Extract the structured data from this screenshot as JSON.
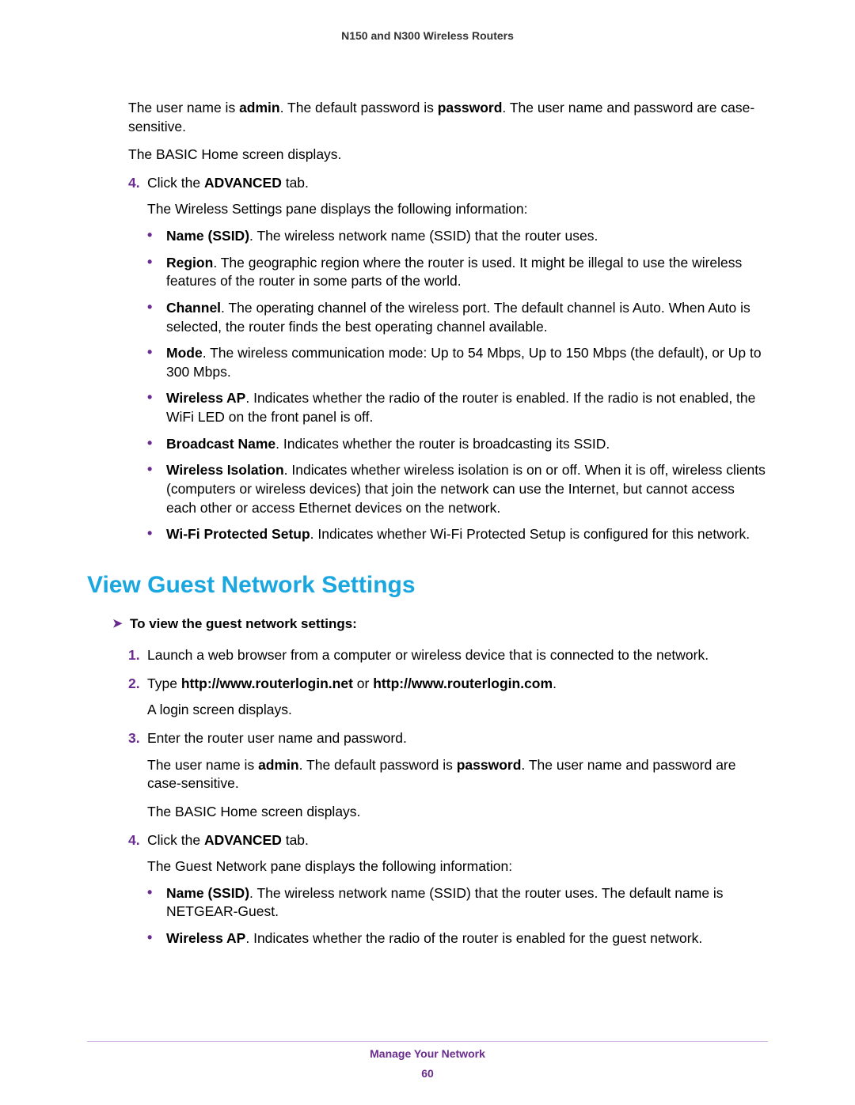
{
  "header": {
    "doc_title": "N150 and N300 Wireless Routers"
  },
  "intro": {
    "p1_a": "The user name is ",
    "p1_b_admin": "admin",
    "p1_c": ". The default password is ",
    "p1_d_password": "password",
    "p1_e": ". The user name and password are case-sensitive.",
    "p2": "The BASIC Home screen displays."
  },
  "step4a": {
    "num": "4.",
    "a": "Click the ",
    "b_adv": "ADVANCED",
    "c": " tab.",
    "follow": "The Wireless Settings pane displays the following information:"
  },
  "bulletsA": [
    {
      "term": "Name (SSID)",
      "text": ". The wireless network name (SSID) that the router uses."
    },
    {
      "term": "Region",
      "text": ". The geographic region where the router is used. It might be illegal to use the wireless features of the router in some parts of the world."
    },
    {
      "term": "Channel",
      "text": ". The operating channel of the wireless port. The default channel is Auto. When Auto is selected, the router finds the best operating channel available."
    },
    {
      "term": "Mode",
      "text": ". The wireless communication mode: Up to 54 Mbps, Up to 150 Mbps (the default), or Up to 300 Mbps."
    },
    {
      "term": "Wireless AP",
      "text": ". Indicates whether the radio of the router is enabled. If the radio is not enabled, the WiFi LED on the front panel is off."
    },
    {
      "term": "Broadcast Name",
      "text": ". Indicates whether the router is broadcasting its SSID."
    },
    {
      "term": "Wireless Isolation",
      "text": ". Indicates whether wireless isolation is on or off. When it is off, wireless clients (computers or wireless devices) that join the network can use the Internet, but cannot access each other or access Ethernet devices on the network."
    },
    {
      "term": "Wi-Fi Protected Setup",
      "text": ". Indicates whether Wi-Fi Protected Setup is configured for this network."
    }
  ],
  "section_title": "View Guest Network Settings",
  "task_heading": "To view the guest network settings:",
  "stepsB": {
    "s1": {
      "num": "1.",
      "text": "Launch a web browser from a computer or wireless device that is connected to the network."
    },
    "s2": {
      "num": "2.",
      "a": "Type ",
      "b_url1": "http://www.routerlogin.net",
      "c": " or ",
      "d_url2": "http://www.routerlogin.com",
      "e": ".",
      "follow": "A login screen displays."
    },
    "s3": {
      "num": "3.",
      "text": "Enter the router user name and password.",
      "p1_a": "The user name is ",
      "p1_b_admin": "admin",
      "p1_c": ". The default password is ",
      "p1_d_password": "password",
      "p1_e": ". The user name and password are case-sensitive.",
      "p2": "The BASIC Home screen displays."
    },
    "s4": {
      "num": "4.",
      "a": "Click the ",
      "b_adv": "ADVANCED",
      "c": " tab.",
      "follow": "The Guest Network pane displays the following information:"
    }
  },
  "bulletsB": [
    {
      "term": "Name (SSID)",
      "text": ". The wireless network name (SSID) that the router uses. The default name is NETGEAR-Guest."
    },
    {
      "term": "Wireless AP",
      "text": ". Indicates whether the radio of the router is enabled for the guest network."
    }
  ],
  "footer": {
    "section": "Manage Your Network",
    "page": "60"
  }
}
